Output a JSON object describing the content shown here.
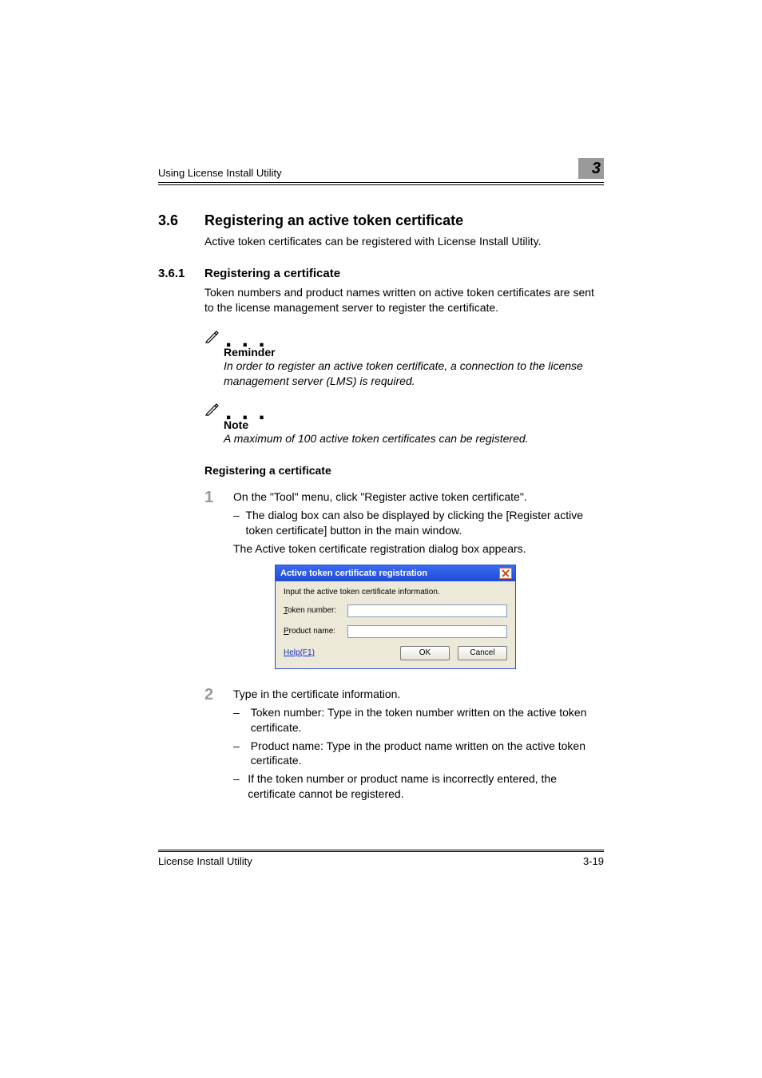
{
  "header": {
    "breadcrumb": "Using License Install Utility",
    "chapter_number": "3"
  },
  "section": {
    "number": "3.6",
    "title": "Registering an active token certificate",
    "intro": "Active token certificates can be registered with License Install Utility."
  },
  "subsection": {
    "number": "3.6.1",
    "title": "Registering a certificate",
    "intro": "Token numbers and product names written on active token certificates are sent to the license management server to register the certificate."
  },
  "reminder": {
    "label": "Reminder",
    "body": "In order to register an active token certificate, a connection to the license management server (LMS) is required."
  },
  "note": {
    "label": "Note",
    "body": "A maximum of 100 active token certificates can be registered."
  },
  "procedure_title": "Registering a certificate",
  "step1": {
    "num": "1",
    "text": "On the \"Tool\" menu, click \"Register active token certificate\".",
    "sub1": "The dialog box can also be displayed by clicking the [Register active token certificate] button in the main window.",
    "after": "The Active token certificate registration dialog box appears."
  },
  "dialog": {
    "title": "Active token certificate registration",
    "prompt": "Input the active token certificate information.",
    "token_number_label_pre": "T",
    "token_number_label_post": "oken number:",
    "product_name_label_pre": "P",
    "product_name_label_post": "roduct name:",
    "help": "Help(F1)",
    "ok": "OK",
    "cancel": "Cancel",
    "token_value": "",
    "product_value": ""
  },
  "step2": {
    "num": "2",
    "text": "Type in the certificate information.",
    "sub1": "Token number: Type in the token number written on the active token certificate.",
    "sub2": "Product name: Type in the product name written on the active token certificate.",
    "sub3": "If the token number or product name is incorrectly entered, the certificate cannot be registered."
  },
  "footer": {
    "product": "License Install Utility",
    "page": "3-19"
  }
}
